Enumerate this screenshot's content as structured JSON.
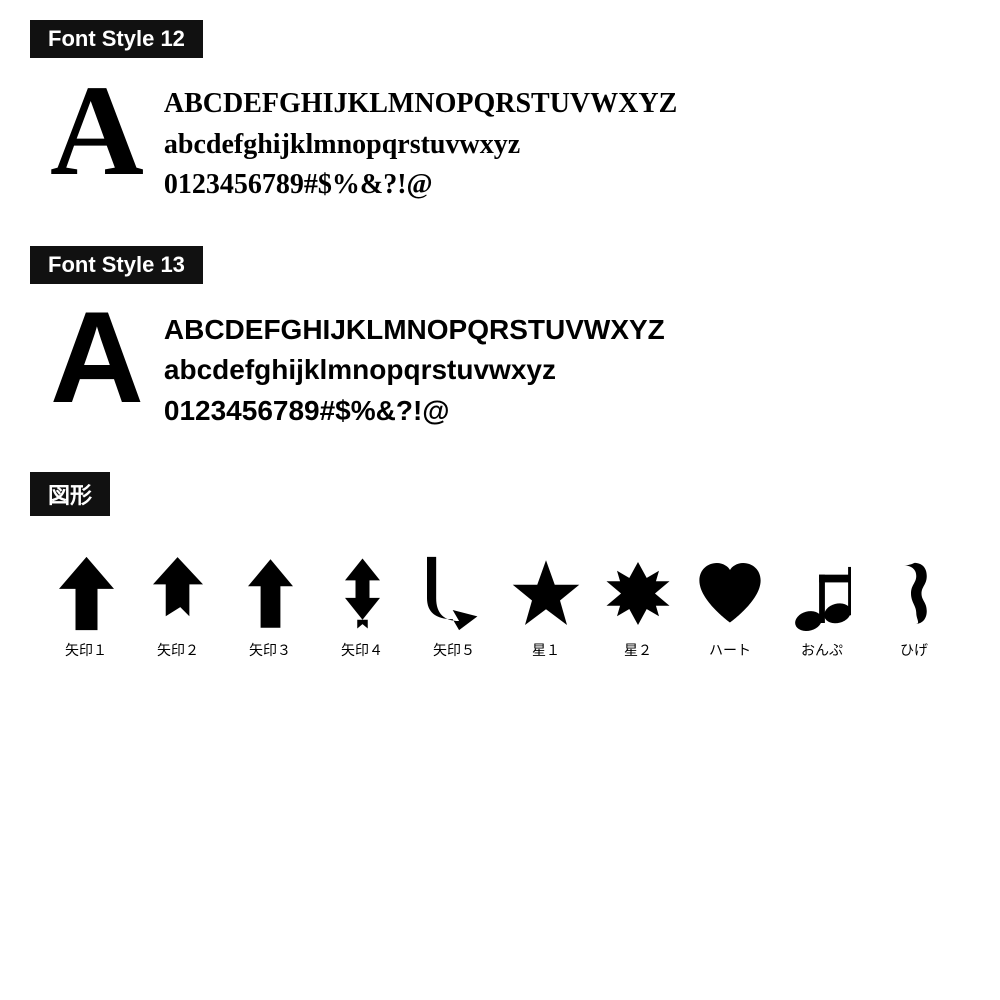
{
  "font12": {
    "label": "Font Style 12",
    "big_letter": "A",
    "line1": "ABCDEFGHIJKLMNOPQRSTUVWXYZ",
    "line2": "abcdefghijklmnopqrstuvwxyz",
    "line3": "0123456789#$%&?!@"
  },
  "font13": {
    "label": "Font Style 13",
    "big_letter": "A",
    "line1": "ABCDEFGHIJKLMNOPQRSTUVWXYZ",
    "line2": "abcdefghijklmnopqrstuvwxyz",
    "line3": "0123456789#$%&?!@"
  },
  "shapes": {
    "label": "図形",
    "items": [
      {
        "name": "矢印1"
      },
      {
        "name": "矢印2"
      },
      {
        "name": "矢印3"
      },
      {
        "name": "矢印4"
      },
      {
        "name": "矢印5"
      },
      {
        "name": "星1"
      },
      {
        "name": "星2"
      },
      {
        "name": "ハート"
      },
      {
        "name": "おんぷ"
      },
      {
        "name": "ひげ"
      }
    ]
  }
}
